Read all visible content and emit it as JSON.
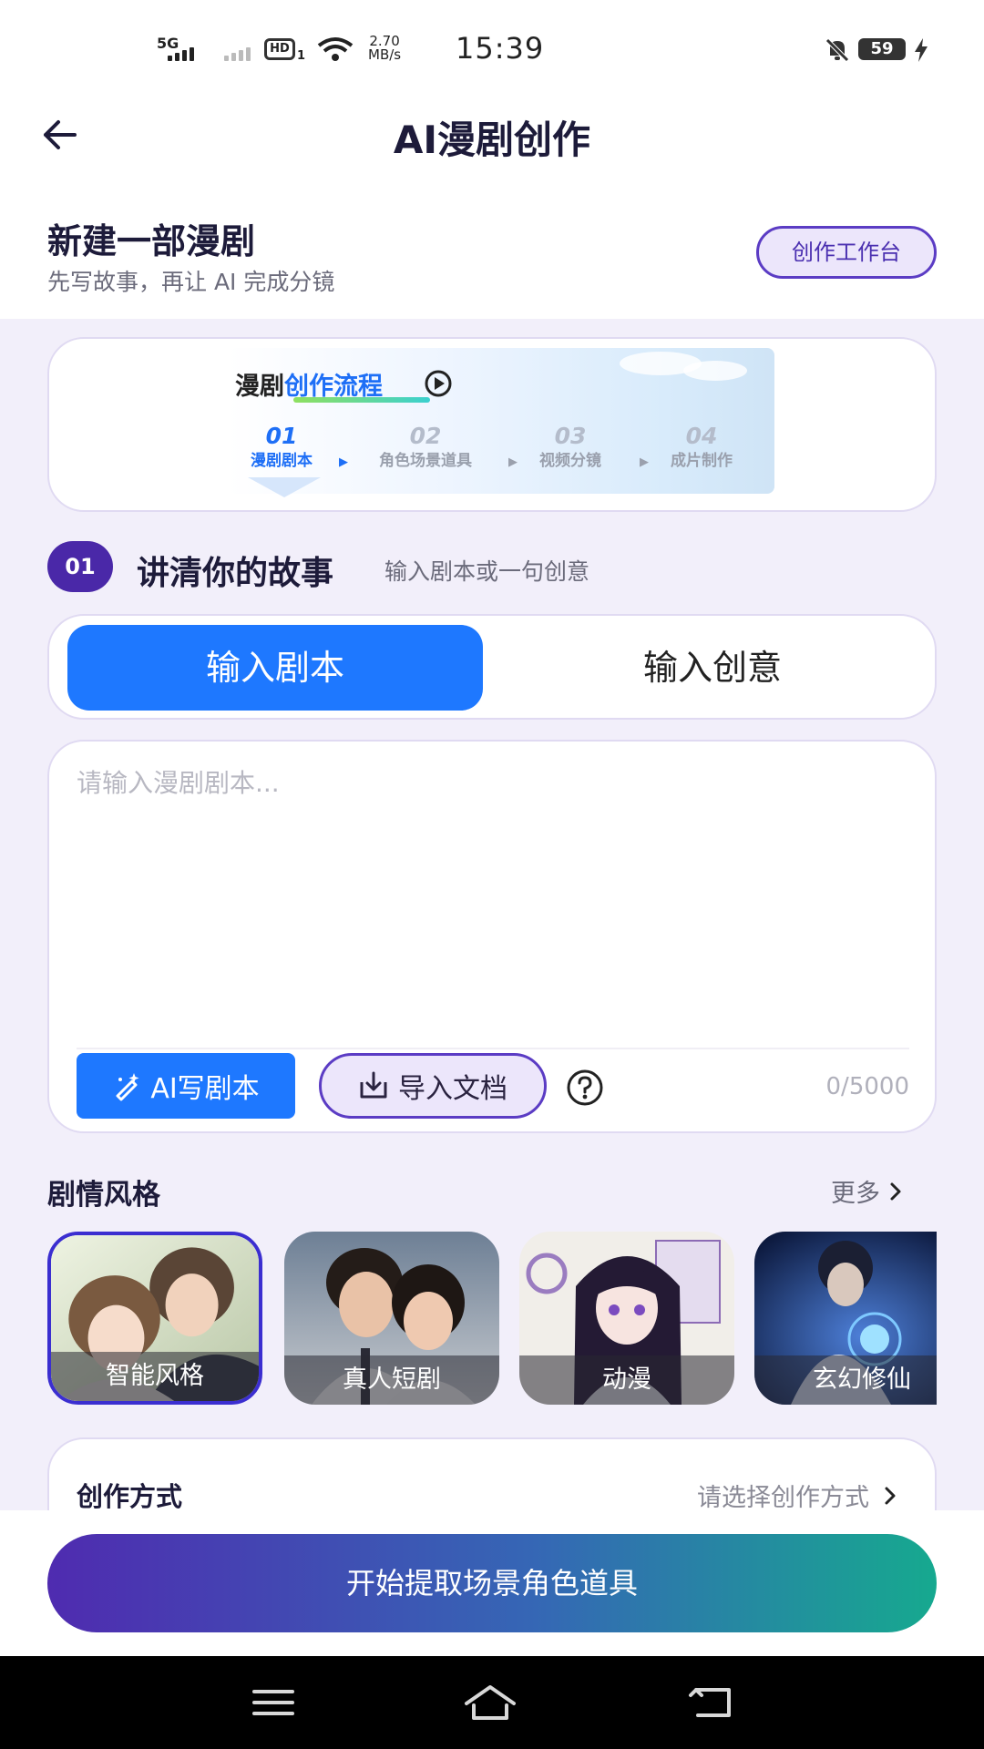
{
  "status_bar": {
    "network": "5G",
    "hd": "HD",
    "hd_sub": "1",
    "speed_value": "2.70",
    "speed_unit": "MB/s",
    "time": "15:39",
    "battery": "59"
  },
  "header": {
    "title": "AI漫剧创作",
    "subtitle": "新建一部漫剧",
    "description": "先写故事，再让 AI 完成分镜",
    "workbench_label": "创作工作台"
  },
  "flow": {
    "title_part1": "漫剧",
    "title_part2": "创作流程",
    "steps": [
      {
        "num": "01",
        "label": "漫剧剧本"
      },
      {
        "num": "02",
        "label": "角色场景道具"
      },
      {
        "num": "03",
        "label": "视频分镜"
      },
      {
        "num": "04",
        "label": "成片制作"
      }
    ],
    "active_step": 0
  },
  "section": {
    "badge": "01",
    "title": "讲清你的故事",
    "hint": "输入剧本或一句创意"
  },
  "input_mode": {
    "options": [
      "输入剧本",
      "输入创意"
    ],
    "selected": "输入剧本"
  },
  "editor": {
    "placeholder": "请输入漫剧剧本...",
    "value": "",
    "ai_write_label": "AI写剧本",
    "import_label": "导入文档",
    "counter": "0/5000"
  },
  "styles": {
    "title": "剧情风格",
    "more_label": "更多",
    "items": [
      {
        "label": "智能风格",
        "selected": true
      },
      {
        "label": "真人短剧",
        "selected": false
      },
      {
        "label": "动漫",
        "selected": false
      },
      {
        "label": "玄幻修仙",
        "selected": false
      }
    ]
  },
  "creation_mode": {
    "label": "创作方式",
    "placeholder": "请选择创作方式"
  },
  "primary_action": {
    "label": "开始提取场景角色道具"
  },
  "colors": {
    "accent_blue": "#1e78ff",
    "accent_purple": "#4a28a8",
    "page_bg": "#f2effa"
  }
}
